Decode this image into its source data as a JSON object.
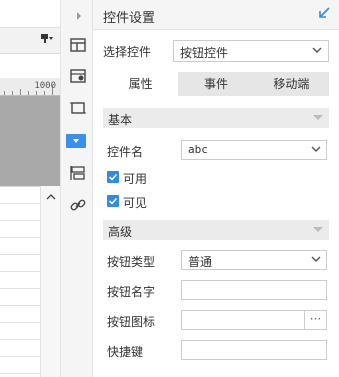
{
  "canvas": {
    "ruler_number": "1000"
  },
  "panel": {
    "title": "控件设置",
    "select_label": "选择控件",
    "select_value": "按钮控件",
    "tabs": [
      {
        "label": "属性",
        "active": true
      },
      {
        "label": "事件",
        "active": false
      },
      {
        "label": "移动端",
        "active": false
      }
    ],
    "section_basic": "基本",
    "control_name_label": "控件名",
    "control_name_value": "abc",
    "enabled_label": "可用",
    "enabled_checked": true,
    "visible_label": "可见",
    "visible_checked": true,
    "section_advanced": "高级",
    "button_type_label": "按钮类型",
    "button_type_value": "普通",
    "button_name_label": "按钮名字",
    "button_name_value": "",
    "button_icon_label": "按钮图标",
    "button_icon_value": "",
    "button_icon_browse": "···",
    "shortcut_label": "快捷键",
    "shortcut_value": ""
  },
  "colors": {
    "accent": "#2f8be6",
    "active_strip_icon": "#3b8fe8"
  }
}
